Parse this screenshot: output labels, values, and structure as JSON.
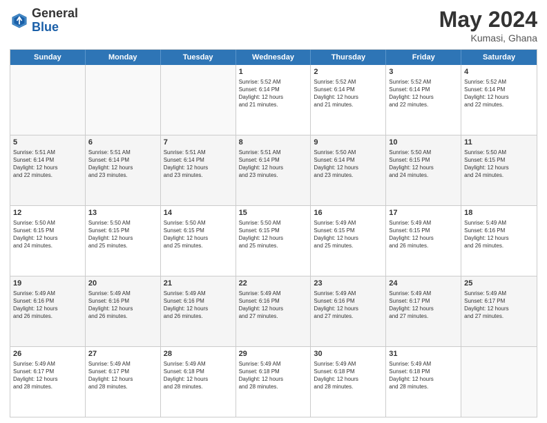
{
  "header": {
    "logo_general": "General",
    "logo_blue": "Blue",
    "month_year": "May 2024",
    "location": "Kumasi, Ghana"
  },
  "columns": [
    "Sunday",
    "Monday",
    "Tuesday",
    "Wednesday",
    "Thursday",
    "Friday",
    "Saturday"
  ],
  "rows": [
    [
      {
        "day": "",
        "info": ""
      },
      {
        "day": "",
        "info": ""
      },
      {
        "day": "",
        "info": ""
      },
      {
        "day": "1",
        "info": "Sunrise: 5:52 AM\nSunset: 6:14 PM\nDaylight: 12 hours\nand 21 minutes."
      },
      {
        "day": "2",
        "info": "Sunrise: 5:52 AM\nSunset: 6:14 PM\nDaylight: 12 hours\nand 21 minutes."
      },
      {
        "day": "3",
        "info": "Sunrise: 5:52 AM\nSunset: 6:14 PM\nDaylight: 12 hours\nand 22 minutes."
      },
      {
        "day": "4",
        "info": "Sunrise: 5:52 AM\nSunset: 6:14 PM\nDaylight: 12 hours\nand 22 minutes."
      }
    ],
    [
      {
        "day": "5",
        "info": "Sunrise: 5:51 AM\nSunset: 6:14 PM\nDaylight: 12 hours\nand 22 minutes."
      },
      {
        "day": "6",
        "info": "Sunrise: 5:51 AM\nSunset: 6:14 PM\nDaylight: 12 hours\nand 23 minutes."
      },
      {
        "day": "7",
        "info": "Sunrise: 5:51 AM\nSunset: 6:14 PM\nDaylight: 12 hours\nand 23 minutes."
      },
      {
        "day": "8",
        "info": "Sunrise: 5:51 AM\nSunset: 6:14 PM\nDaylight: 12 hours\nand 23 minutes."
      },
      {
        "day": "9",
        "info": "Sunrise: 5:50 AM\nSunset: 6:14 PM\nDaylight: 12 hours\nand 23 minutes."
      },
      {
        "day": "10",
        "info": "Sunrise: 5:50 AM\nSunset: 6:15 PM\nDaylight: 12 hours\nand 24 minutes."
      },
      {
        "day": "11",
        "info": "Sunrise: 5:50 AM\nSunset: 6:15 PM\nDaylight: 12 hours\nand 24 minutes."
      }
    ],
    [
      {
        "day": "12",
        "info": "Sunrise: 5:50 AM\nSunset: 6:15 PM\nDaylight: 12 hours\nand 24 minutes."
      },
      {
        "day": "13",
        "info": "Sunrise: 5:50 AM\nSunset: 6:15 PM\nDaylight: 12 hours\nand 25 minutes."
      },
      {
        "day": "14",
        "info": "Sunrise: 5:50 AM\nSunset: 6:15 PM\nDaylight: 12 hours\nand 25 minutes."
      },
      {
        "day": "15",
        "info": "Sunrise: 5:50 AM\nSunset: 6:15 PM\nDaylight: 12 hours\nand 25 minutes."
      },
      {
        "day": "16",
        "info": "Sunrise: 5:49 AM\nSunset: 6:15 PM\nDaylight: 12 hours\nand 25 minutes."
      },
      {
        "day": "17",
        "info": "Sunrise: 5:49 AM\nSunset: 6:15 PM\nDaylight: 12 hours\nand 26 minutes."
      },
      {
        "day": "18",
        "info": "Sunrise: 5:49 AM\nSunset: 6:16 PM\nDaylight: 12 hours\nand 26 minutes."
      }
    ],
    [
      {
        "day": "19",
        "info": "Sunrise: 5:49 AM\nSunset: 6:16 PM\nDaylight: 12 hours\nand 26 minutes."
      },
      {
        "day": "20",
        "info": "Sunrise: 5:49 AM\nSunset: 6:16 PM\nDaylight: 12 hours\nand 26 minutes."
      },
      {
        "day": "21",
        "info": "Sunrise: 5:49 AM\nSunset: 6:16 PM\nDaylight: 12 hours\nand 26 minutes."
      },
      {
        "day": "22",
        "info": "Sunrise: 5:49 AM\nSunset: 6:16 PM\nDaylight: 12 hours\nand 27 minutes."
      },
      {
        "day": "23",
        "info": "Sunrise: 5:49 AM\nSunset: 6:16 PM\nDaylight: 12 hours\nand 27 minutes."
      },
      {
        "day": "24",
        "info": "Sunrise: 5:49 AM\nSunset: 6:17 PM\nDaylight: 12 hours\nand 27 minutes."
      },
      {
        "day": "25",
        "info": "Sunrise: 5:49 AM\nSunset: 6:17 PM\nDaylight: 12 hours\nand 27 minutes."
      }
    ],
    [
      {
        "day": "26",
        "info": "Sunrise: 5:49 AM\nSunset: 6:17 PM\nDaylight: 12 hours\nand 28 minutes."
      },
      {
        "day": "27",
        "info": "Sunrise: 5:49 AM\nSunset: 6:17 PM\nDaylight: 12 hours\nand 28 minutes."
      },
      {
        "day": "28",
        "info": "Sunrise: 5:49 AM\nSunset: 6:18 PM\nDaylight: 12 hours\nand 28 minutes."
      },
      {
        "day": "29",
        "info": "Sunrise: 5:49 AM\nSunset: 6:18 PM\nDaylight: 12 hours\nand 28 minutes."
      },
      {
        "day": "30",
        "info": "Sunrise: 5:49 AM\nSunset: 6:18 PM\nDaylight: 12 hours\nand 28 minutes."
      },
      {
        "day": "31",
        "info": "Sunrise: 5:49 AM\nSunset: 6:18 PM\nDaylight: 12 hours\nand 28 minutes."
      },
      {
        "day": "",
        "info": ""
      }
    ]
  ]
}
